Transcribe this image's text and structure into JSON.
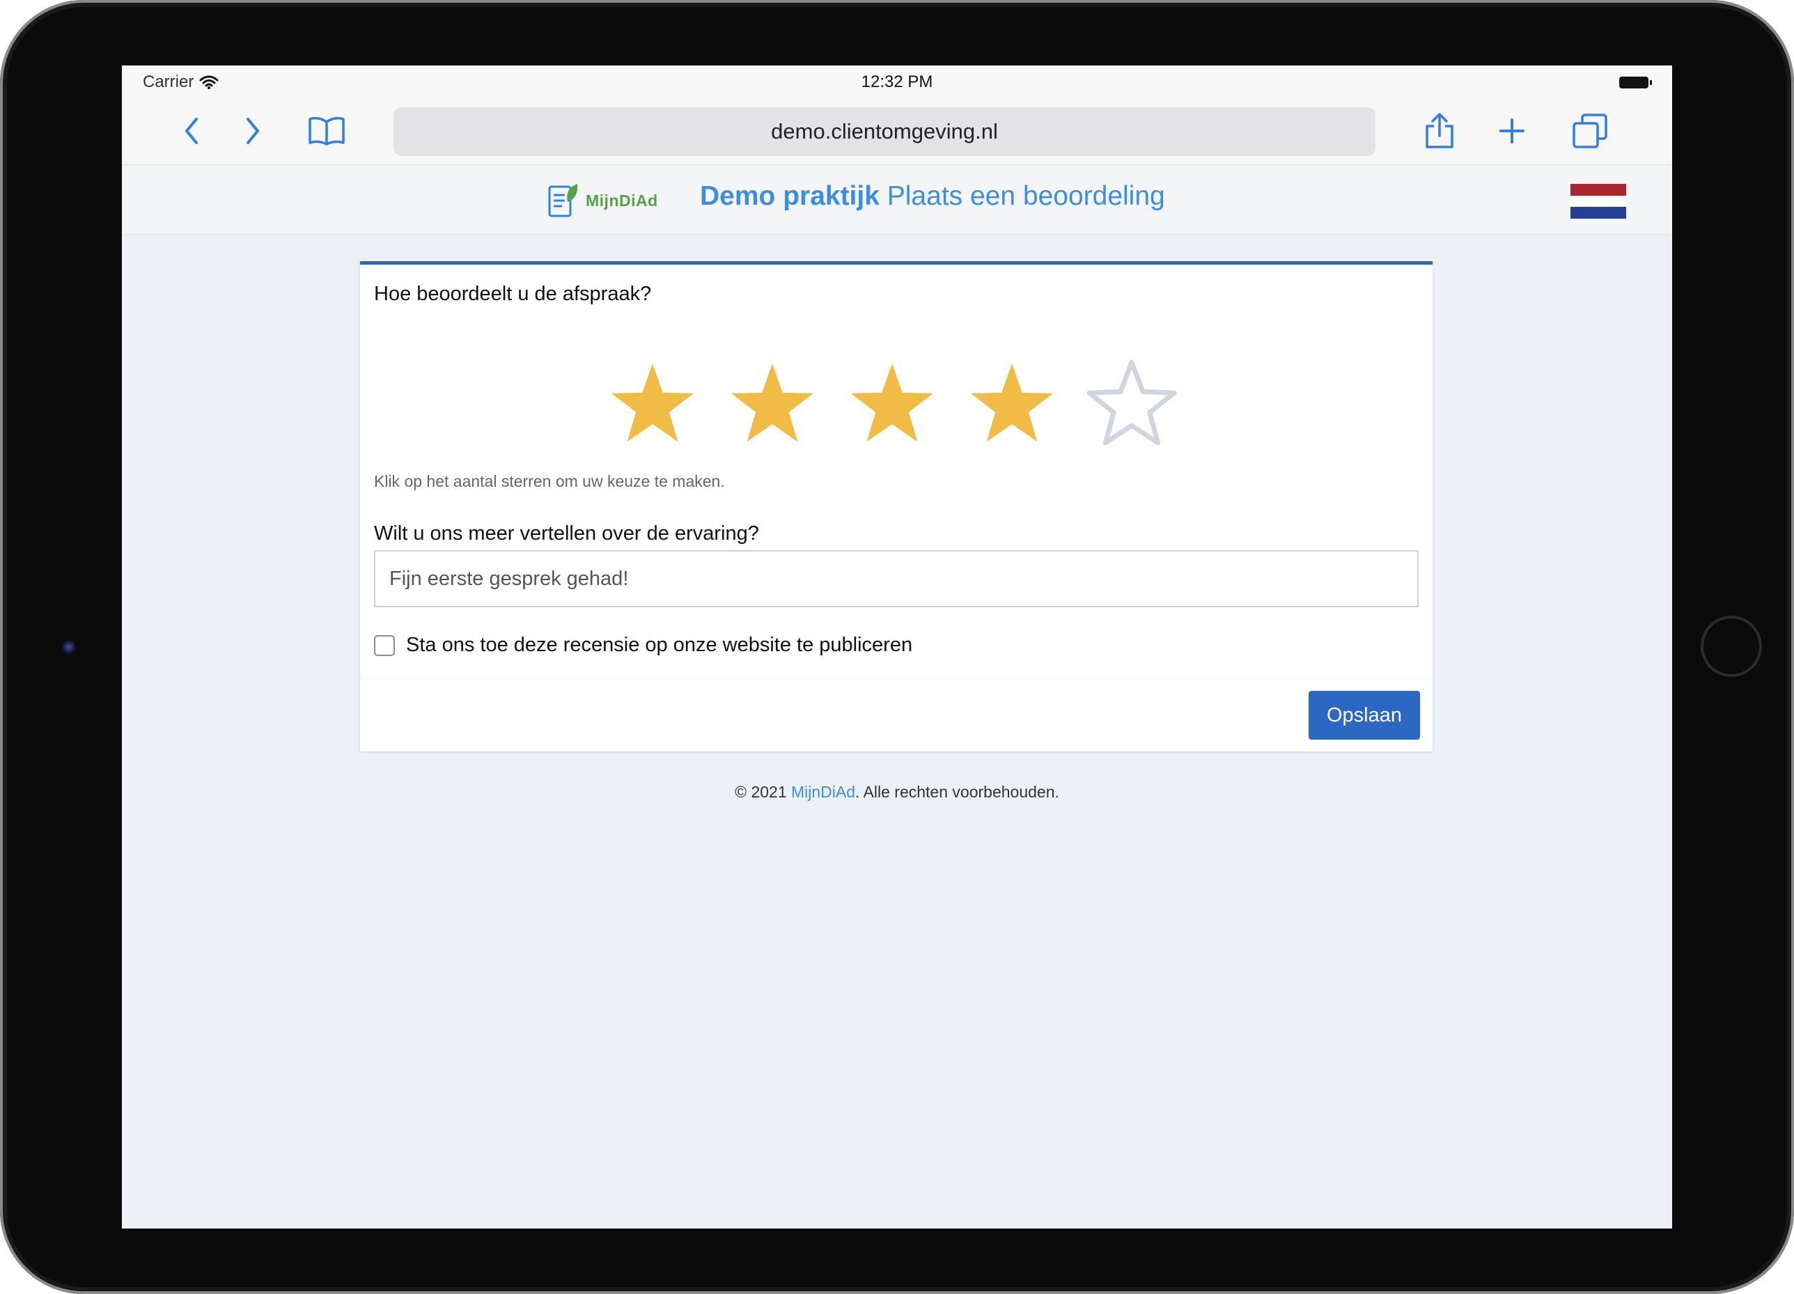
{
  "status_bar": {
    "carrier": "Carrier",
    "time": "12:32 PM"
  },
  "browser": {
    "url": "demo.clientomgeving.nl",
    "icons": [
      "back-icon",
      "forward-icon",
      "bookmarks-icon",
      "share-icon",
      "new-tab-icon",
      "tabs-icon"
    ]
  },
  "header": {
    "logo_text": "MijnDiAd",
    "title_bold": "Demo praktijk",
    "title_rest": " Plaats een beoordeling",
    "language_flag": "nl-flag-icon"
  },
  "form": {
    "question_rating": "Hoe beoordeelt u de afspraak?",
    "rating": {
      "value": 4,
      "max": 5
    },
    "rating_hint": "Klik op het aantal sterren om uw keuze te maken.",
    "question_experience": "Wilt u ons meer vertellen over de ervaring?",
    "experience_value": "Fijn eerste gesprek gehad!",
    "publish_label": "Sta ons toe deze recensie op onze website te publiceren",
    "publish_checked": false,
    "save_label": "Opslaan"
  },
  "footer": {
    "prefix": "© 2021 ",
    "brand_link": "MijnDiAd",
    "suffix": ". Alle rechten voorbehouden."
  },
  "colors": {
    "accent": "#2d67c4",
    "title_blue": "#3d8ee0",
    "star_filled": "#f0bc45",
    "star_empty": "#cfd6df",
    "logo_green": "#56a04a"
  }
}
